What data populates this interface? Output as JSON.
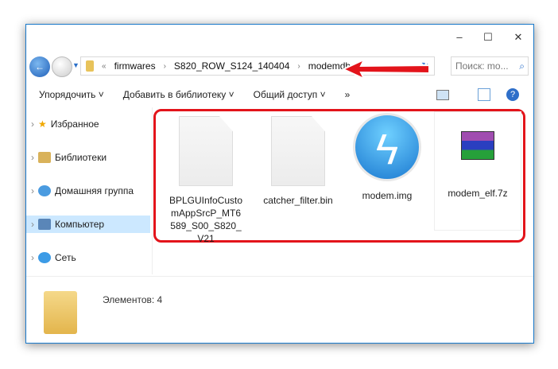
{
  "window": {
    "minimize": "–",
    "maximize": "☐",
    "close": "✕"
  },
  "address": {
    "overflow": "«",
    "crumbs": [
      "firmwares",
      "S820_ROW_S124_140404",
      "modemdb"
    ],
    "separator": "›"
  },
  "search": {
    "placeholder": "Поиск: mo..."
  },
  "toolbar": {
    "organize": "Упорядочить ˅",
    "add_library": "Добавить в библиотеку ˅",
    "share": "Общий доступ ˅",
    "more": "»"
  },
  "sidebar": {
    "items": [
      {
        "label": "Избранное"
      },
      {
        "label": "Библиотеки"
      },
      {
        "label": "Домашняя группа"
      },
      {
        "label": "Компьютер"
      },
      {
        "label": "Сеть"
      }
    ]
  },
  "files": [
    {
      "name": "BPLGUInfoCustomAppSrcP_MT6589_S00_S820_V21"
    },
    {
      "name": "catcher_filter.bin"
    },
    {
      "name": "modem.img"
    },
    {
      "name": "modem_elf.7z"
    }
  ],
  "status": {
    "count": "Элементов: 4"
  },
  "colors": {
    "highlight": "#e3141b",
    "selected": "#cce8ff"
  }
}
